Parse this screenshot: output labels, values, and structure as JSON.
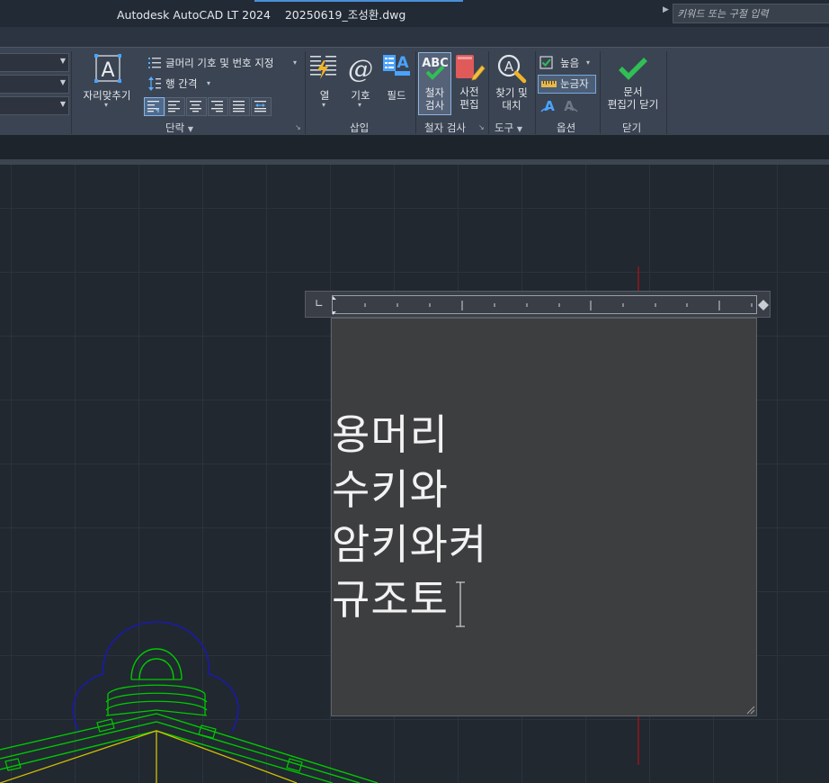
{
  "titlebar": {
    "app_name": "Autodesk AutoCAD LT 2024",
    "file_name": "20250619_조성환.dwg",
    "search_placeholder": "키워드 또는 구절 입력"
  },
  "ribbon": {
    "paragraph": {
      "justify_label": "자리맞추기",
      "bullets_label": "글머리 기호 및 번호 지정",
      "line_spacing_label": "행 간격",
      "panel_title": "단락"
    },
    "insert": {
      "columns_label": "열",
      "symbol_label": "기호",
      "field_label": "필드",
      "panel_title": "삽입"
    },
    "spell": {
      "spell_check_label_1": "철자",
      "spell_check_label_2": "검사",
      "dict_label_1": "사전",
      "dict_label_2": "편집",
      "panel_title": "철자 검사"
    },
    "tools": {
      "find_label_1": "찾기 및",
      "find_label_2": "대치",
      "panel_title": "도구"
    },
    "options": {
      "height_label": "높음",
      "ruler_label": "눈금자",
      "panel_title": "옵션"
    },
    "close": {
      "close_label_1": "문서",
      "close_label_2": "편집기 닫기",
      "panel_title": "닫기"
    }
  },
  "editor": {
    "lines": [
      "용머리",
      "수키와",
      "암키와켜",
      "규조토"
    ]
  },
  "colors": {
    "ribbon_bg": "#3b4453",
    "canvas_bg": "#212830",
    "roof_green": "#00c800",
    "roof_blue": "#1a1aa8",
    "roof_yellow": "#d0c000",
    "guide_red": "#c81010",
    "check_green": "#2fbf55"
  }
}
